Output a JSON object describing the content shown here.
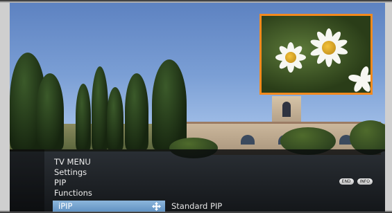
{
  "menu": {
    "breadcrumb": [
      "TV MENU",
      "Settings",
      "PIP",
      "Functions"
    ],
    "selected_item": {
      "label": "iPIP",
      "value": "Standard PIP"
    },
    "keys": {
      "end": "END",
      "info": "INFO"
    }
  },
  "pip": {
    "border_color": "#f28a1e"
  },
  "colors": {
    "highlight": "#7aa6d2"
  },
  "icons": {
    "adjust": "four-way-arrow-icon"
  }
}
